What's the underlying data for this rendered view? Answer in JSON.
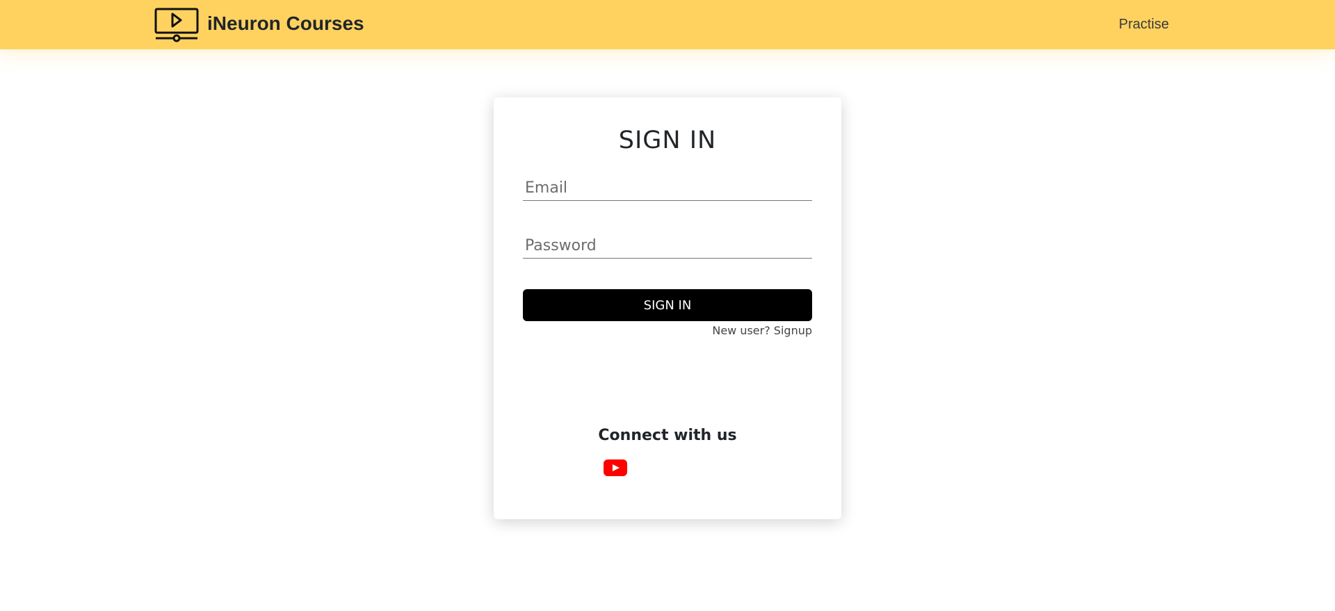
{
  "header": {
    "brand": "iNeuron Courses",
    "nav_link": "Practise"
  },
  "signin": {
    "title": "SIGN IN",
    "email_placeholder": "Email",
    "password_placeholder": "Password",
    "button_label": "SIGN IN",
    "signup_link": "New user? Signup",
    "connect_heading": "Connect with us"
  },
  "colors": {
    "header_bg": "#ffd260",
    "button_bg": "#000000",
    "youtube": "#ff0000"
  }
}
